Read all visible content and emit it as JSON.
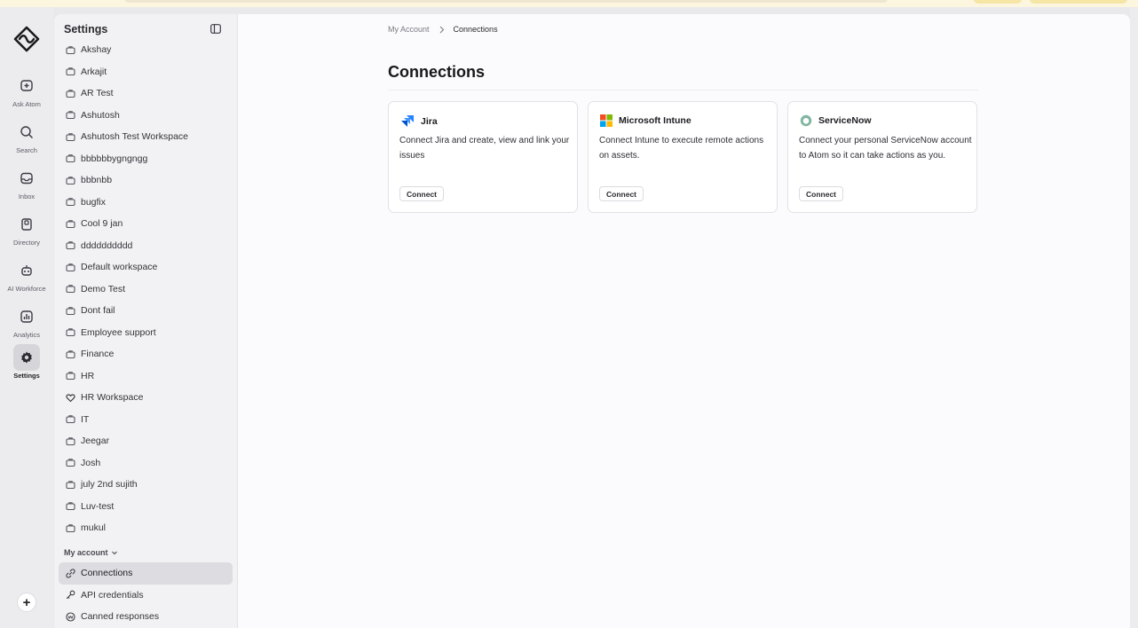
{
  "rail": {
    "items": [
      {
        "label": "Ask Atom",
        "icon": "ask-atom-icon"
      },
      {
        "label": "Search",
        "icon": "search-icon"
      },
      {
        "label": "Inbox",
        "icon": "inbox-icon"
      },
      {
        "label": "Directory",
        "icon": "directory-icon"
      },
      {
        "label": "AI Workforce",
        "icon": "robot-icon"
      },
      {
        "label": "Analytics",
        "icon": "analytics-icon"
      },
      {
        "label": "Settings",
        "icon": "gear-icon",
        "active": true
      }
    ],
    "add_label": "+"
  },
  "sidebar": {
    "title": "Settings",
    "workspaces": [
      "Akshay",
      "Arkajit",
      "AR Test",
      "Ashutosh",
      "Ashutosh Test Workspace",
      "bbbbbbygngngg",
      "bbbnbb",
      "bugfix",
      "Cool 9 jan",
      "dddddddddd",
      "Default workspace",
      "Demo Test",
      "Dont fail",
      "Employee support",
      "Finance",
      "HR",
      "HR Workspace",
      "IT",
      "Jeegar",
      "Josh",
      "july 2nd sujith",
      "Luv-test",
      "mukul"
    ],
    "account_section": "My account",
    "account_items": [
      {
        "label": "Connections",
        "icon": "link-icon",
        "active": true
      },
      {
        "label": "API credentials",
        "icon": "key-icon"
      },
      {
        "label": "Canned responses",
        "icon": "canned-responses-icon"
      }
    ]
  },
  "main": {
    "breadcrumb": {
      "parent": "My Account",
      "current": "Connections"
    },
    "title": "Connections",
    "cards": [
      {
        "name": "Jira",
        "icon": "jira-icon",
        "description": "Connect Jira and create, view and link your issues",
        "button": "Connect"
      },
      {
        "name": "Microsoft Intune",
        "icon": "microsoft-icon",
        "description": "Connect Intune to execute remote actions on assets.",
        "button": "Connect"
      },
      {
        "name": "ServiceNow",
        "icon": "servicenow-icon",
        "description": "Connect your personal ServiceNow account to Atom so it can take actions as you.",
        "button": "Connect"
      }
    ]
  },
  "colors": {
    "active_bg": "#dcdce1",
    "jira_blue": "#2684ff",
    "servicenow_green": "#81b5a1"
  }
}
